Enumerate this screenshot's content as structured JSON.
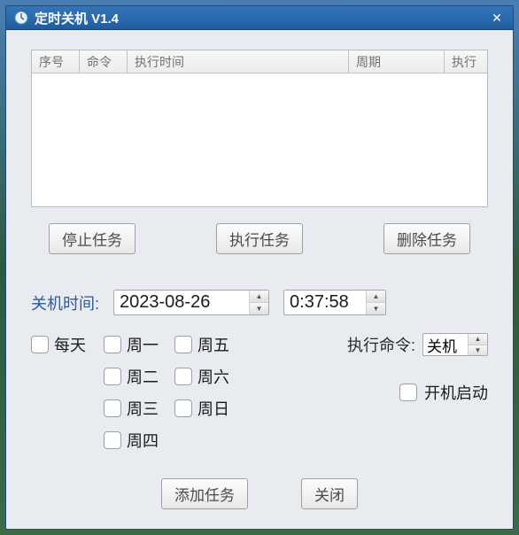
{
  "window": {
    "title": "定时关机 V1.4"
  },
  "table": {
    "headers": {
      "seq": "序号",
      "cmd": "命令",
      "time": "执行时间",
      "period": "周期",
      "exec": "执行"
    }
  },
  "buttons": {
    "stop": "停止任务",
    "execute": "执行任务",
    "delete": "删除任务",
    "add": "添加任务",
    "close": "关闭"
  },
  "labels": {
    "shutdown_time": "关机时间:",
    "everyday": "每天",
    "mon": "周一",
    "tue": "周二",
    "wed": "周三",
    "thu": "周四",
    "fri": "周五",
    "sat": "周六",
    "sun": "周日",
    "exec_cmd": "执行命令:",
    "startup": "开机启动"
  },
  "values": {
    "date": "2023-08-26",
    "time": "0:37:58",
    "command": "关机"
  }
}
